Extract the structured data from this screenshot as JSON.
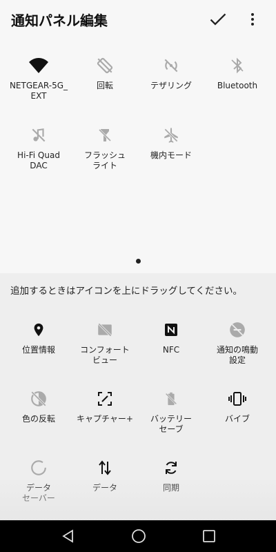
{
  "header": {
    "title": "通知パネル編集"
  },
  "active_tiles": [
    {
      "label": "NETGEAR-5G_\nEXT"
    },
    {
      "label": "回転"
    },
    {
      "label": "テザリング"
    },
    {
      "label": "Bluetooth"
    },
    {
      "label": "Hi-Fi Quad\nDAC"
    },
    {
      "label": "フラッシュ\nライト"
    },
    {
      "label": "機内モード"
    }
  ],
  "hint": "追加するときはアイコンを上にドラッグしてください。",
  "available_tiles": [
    {
      "label": "位置情報"
    },
    {
      "label": "コンフォート\nビュー"
    },
    {
      "label": "NFC"
    },
    {
      "label": "通知の鳴動\n設定"
    },
    {
      "label": "色の反転"
    },
    {
      "label": "キャプチャー+"
    },
    {
      "label": "バッテリー\nセーブ"
    },
    {
      "label": "バイブ"
    },
    {
      "label": "データ\nセーバー"
    },
    {
      "label": "データ"
    },
    {
      "label": "同期"
    }
  ],
  "icons": [
    "check-icon",
    "more-vert-icon",
    "wifi-icon",
    "rotate-icon",
    "hotspot-icon",
    "bluetooth-icon",
    "hifi-dac-icon",
    "flashlight-icon",
    "airplane-icon",
    "location-icon",
    "comfort-view-icon",
    "nfc-icon",
    "notification-sound-icon",
    "color-invert-icon",
    "capture-plus-icon",
    "battery-saver-icon",
    "vibrate-icon",
    "data-saver-icon",
    "data-icon",
    "sync-icon",
    "back-icon",
    "home-icon",
    "recents-icon"
  ]
}
